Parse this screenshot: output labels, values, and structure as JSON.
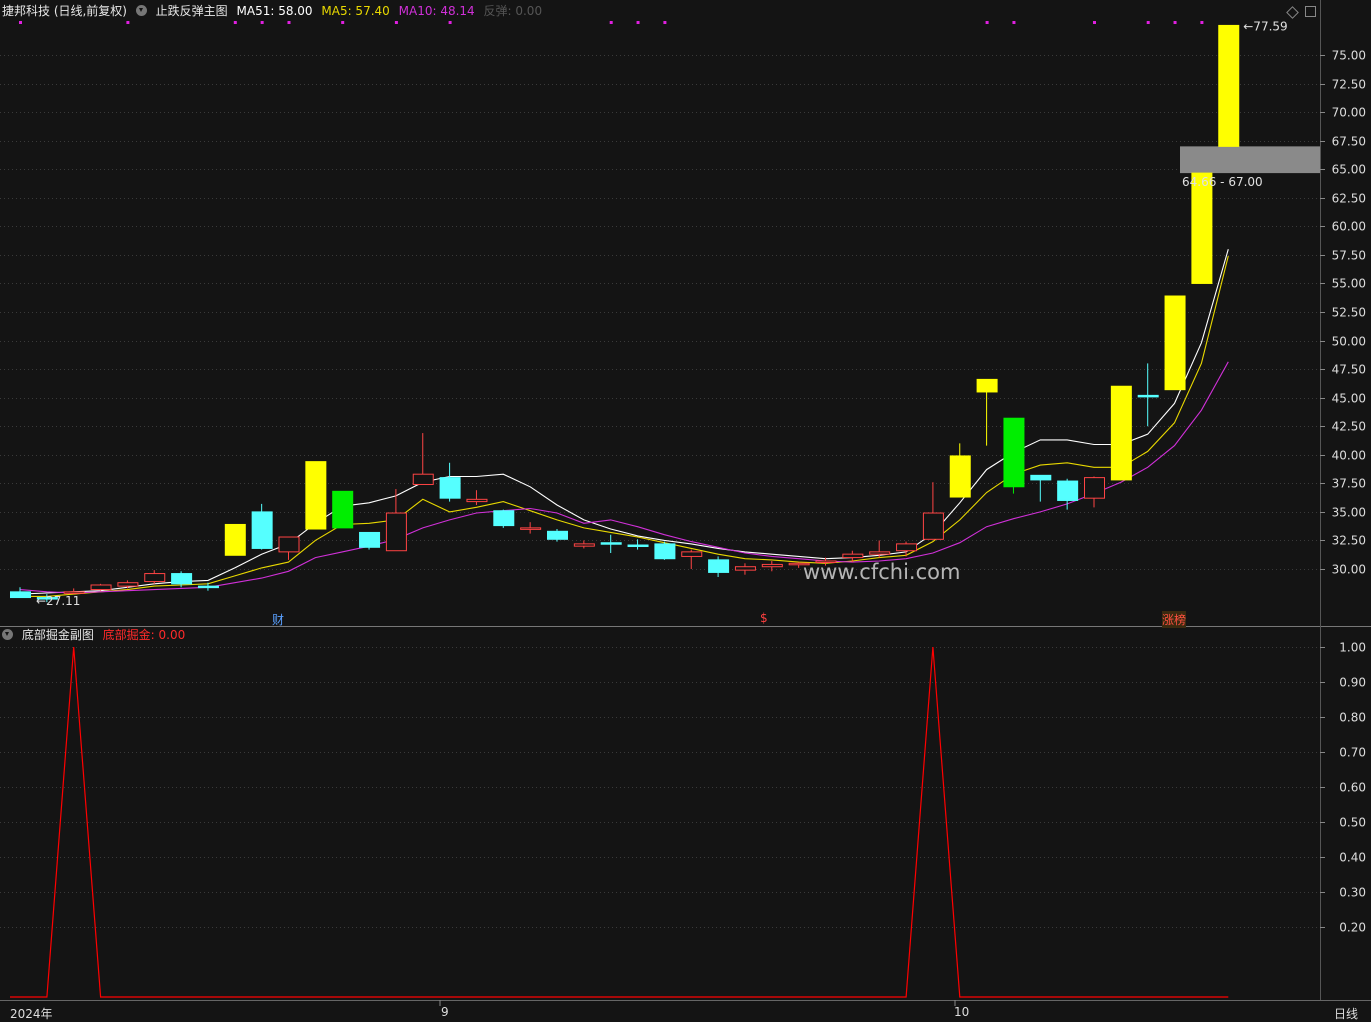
{
  "main_panel": {
    "stock_title": "捷邦科技 (日线,前复权)",
    "indicator_name": "止跌反弹主图",
    "ma51_label": "MA51: 58.00",
    "ma5_label": "MA5: 57.40",
    "ma10_label": "MA10: 48.14",
    "rebound_label": "反弹: 0.00",
    "high_label": "77.59",
    "low_label": "27.11",
    "zone_label": "64.66 - 67.00",
    "watermark": "www.cfchi.com",
    "markers": [
      {
        "label": "财",
        "color": "#5aa0ff"
      },
      {
        "label": "$",
        "color": "#ff4040"
      },
      {
        "label": "涨榜",
        "color": "#ff5040"
      }
    ]
  },
  "sub_panel": {
    "indicator_name": "底部掘金副图",
    "value_label": "底部掘金: 0.00"
  },
  "footer": {
    "x_labels": [
      "2024年",
      "9",
      "10"
    ],
    "period_label": "日线"
  },
  "colors": {
    "background": "#141414",
    "up": "#ff4444",
    "down": "#55ffff",
    "limit_up": "#ffff00",
    "strong_down": "#00ee00",
    "ma51": "#ffffff",
    "ma5": "#e8d800",
    "ma10": "#d030d8",
    "signal": "#ff0000",
    "grid": "#3a3a3a",
    "dots": "#e020e0",
    "zone": "#8a8a8a"
  },
  "chart_data": [
    {
      "type": "candlestick",
      "y_axis_ticks": [
        "75.00",
        "72.50",
        "70.00",
        "67.50",
        "65.00",
        "62.50",
        "60.00",
        "57.50",
        "55.00",
        "52.50",
        "50.00",
        "47.50",
        "45.00",
        "42.50",
        "40.00",
        "37.50",
        "35.00",
        "32.50",
        "30.00"
      ],
      "ylim": [
        26.0,
        78.5
      ],
      "candles": [
        {
          "o": 28.0,
          "h": 28.4,
          "l": 27.5,
          "c": 27.5,
          "k": "down"
        },
        {
          "o": 27.4,
          "h": 27.8,
          "l": 27.1,
          "c": 27.5,
          "k": "down"
        },
        {
          "o": 28.0,
          "h": 28.3,
          "l": 27.8,
          "c": 28.0,
          "k": "up"
        },
        {
          "o": 28.2,
          "h": 28.7,
          "l": 28.1,
          "c": 28.6,
          "k": "up"
        },
        {
          "o": 28.5,
          "h": 29.0,
          "l": 28.3,
          "c": 28.8,
          "k": "up"
        },
        {
          "o": 28.9,
          "h": 29.9,
          "l": 28.7,
          "c": 29.6,
          "k": "up"
        },
        {
          "o": 29.6,
          "h": 29.8,
          "l": 28.4,
          "c": 28.7,
          "k": "down"
        },
        {
          "o": 28.5,
          "h": 28.8,
          "l": 28.1,
          "c": 28.5,
          "k": "down"
        },
        {
          "o": 31.2,
          "h": 33.9,
          "l": 31.2,
          "c": 33.9,
          "k": "limit"
        },
        {
          "o": 35.0,
          "h": 35.7,
          "l": 31.7,
          "c": 31.8,
          "k": "down"
        },
        {
          "o": 31.5,
          "h": 32.8,
          "l": 30.8,
          "c": 32.8,
          "k": "up"
        },
        {
          "o": 33.5,
          "h": 39.4,
          "l": 33.5,
          "c": 39.4,
          "k": "limit"
        },
        {
          "o": 36.8,
          "h": 36.8,
          "l": 33.6,
          "c": 33.6,
          "k": "strong"
        },
        {
          "o": 33.2,
          "h": 33.2,
          "l": 31.7,
          "c": 31.9,
          "k": "down"
        },
        {
          "o": 31.6,
          "h": 37.0,
          "l": 31.6,
          "c": 34.9,
          "k": "up"
        },
        {
          "o": 37.4,
          "h": 41.9,
          "l": 37.4,
          "c": 38.3,
          "k": "up"
        },
        {
          "o": 38.0,
          "h": 39.3,
          "l": 35.9,
          "c": 36.2,
          "k": "down"
        },
        {
          "o": 35.9,
          "h": 36.9,
          "l": 35.6,
          "c": 36.1,
          "k": "up"
        },
        {
          "o": 35.1,
          "h": 35.2,
          "l": 33.6,
          "c": 33.8,
          "k": "down"
        },
        {
          "o": 33.6,
          "h": 34.1,
          "l": 33.1,
          "c": 33.6,
          "k": "up"
        },
        {
          "o": 33.3,
          "h": 33.5,
          "l": 32.4,
          "c": 32.6,
          "k": "down"
        },
        {
          "o": 32.2,
          "h": 32.5,
          "l": 31.8,
          "c": 32.0,
          "k": "up"
        },
        {
          "o": 32.3,
          "h": 33.0,
          "l": 31.4,
          "c": 32.2,
          "k": "down"
        },
        {
          "o": 32.1,
          "h": 32.6,
          "l": 31.7,
          "c": 32.0,
          "k": "down"
        },
        {
          "o": 32.2,
          "h": 32.4,
          "l": 30.8,
          "c": 30.9,
          "k": "down"
        },
        {
          "o": 31.1,
          "h": 31.7,
          "l": 30.0,
          "c": 31.5,
          "k": "up"
        },
        {
          "o": 30.8,
          "h": 31.1,
          "l": 29.3,
          "c": 29.7,
          "k": "down"
        },
        {
          "o": 29.9,
          "h": 30.5,
          "l": 29.5,
          "c": 30.2,
          "k": "up"
        },
        {
          "o": 30.2,
          "h": 30.7,
          "l": 29.8,
          "c": 30.4,
          "k": "up"
        },
        {
          "o": 30.5,
          "h": 30.6,
          "l": 30.1,
          "c": 30.5,
          "k": "up"
        },
        {
          "o": 30.6,
          "h": 31.0,
          "l": 30.3,
          "c": 30.7,
          "k": "up"
        },
        {
          "o": 31.0,
          "h": 31.6,
          "l": 30.6,
          "c": 31.3,
          "k": "up"
        },
        {
          "o": 31.3,
          "h": 32.5,
          "l": 31.0,
          "c": 31.5,
          "k": "up"
        },
        {
          "o": 31.6,
          "h": 32.4,
          "l": 31.1,
          "c": 32.2,
          "k": "up"
        },
        {
          "o": 32.6,
          "h": 37.6,
          "l": 32.6,
          "c": 34.9,
          "k": "up"
        },
        {
          "o": 36.3,
          "h": 41.0,
          "l": 36.3,
          "c": 39.9,
          "k": "limit"
        },
        {
          "o": 46.6,
          "h": 46.6,
          "l": 40.8,
          "c": 45.5,
          "k": "limit"
        },
        {
          "o": 43.2,
          "h": 43.2,
          "l": 36.6,
          "c": 37.2,
          "k": "strong"
        },
        {
          "o": 38.2,
          "h": 38.2,
          "l": 35.9,
          "c": 37.8,
          "k": "down"
        },
        {
          "o": 37.7,
          "h": 37.9,
          "l": 35.2,
          "c": 36.0,
          "k": "down"
        },
        {
          "o": 36.2,
          "h": 38.1,
          "l": 35.4,
          "c": 38.0,
          "k": "up"
        },
        {
          "o": 37.8,
          "h": 46.0,
          "l": 37.8,
          "c": 46.0,
          "k": "limit"
        },
        {
          "o": 45.2,
          "h": 48.0,
          "l": 42.5,
          "c": 45.2,
          "k": "down"
        },
        {
          "o": 45.7,
          "h": 53.9,
          "l": 45.7,
          "c": 53.9,
          "k": "limit"
        },
        {
          "o": 55.0,
          "h": 64.66,
          "l": 55.0,
          "c": 64.66,
          "k": "limit"
        },
        {
          "o": 67.0,
          "h": 77.59,
          "l": 67.0,
          "c": 77.59,
          "k": "limit"
        }
      ],
      "series": [
        {
          "name": "MA51",
          "values": [
            27.8,
            27.9,
            28.0,
            28.1,
            28.4,
            28.7,
            28.9,
            29.0,
            30.1,
            31.3,
            32.2,
            34.0,
            35.5,
            35.8,
            36.4,
            37.6,
            38.1,
            38.1,
            38.3,
            37.2,
            35.6,
            34.3,
            33.5,
            32.9,
            32.5,
            32.2,
            31.8,
            31.5,
            31.3,
            31.1,
            30.9,
            31.0,
            31.2,
            31.5,
            33.1,
            35.8,
            38.7,
            40.2,
            41.3,
            41.3,
            40.9,
            40.9,
            41.8,
            44.5,
            49.8,
            58.0
          ]
        },
        {
          "name": "MA5",
          "values": [
            27.6,
            27.6,
            27.8,
            28.0,
            28.2,
            28.5,
            28.6,
            28.7,
            29.4,
            30.1,
            30.6,
            32.5,
            33.9,
            34.0,
            34.3,
            36.1,
            35.0,
            35.4,
            35.9,
            35.1,
            34.3,
            33.6,
            33.2,
            32.8,
            32.3,
            31.8,
            31.3,
            30.9,
            30.8,
            30.6,
            30.5,
            30.7,
            31.0,
            31.2,
            32.4,
            34.3,
            36.7,
            38.3,
            39.1,
            39.3,
            38.9,
            38.9,
            40.3,
            42.8,
            48.0,
            57.4
          ]
        },
        {
          "name": "MA10",
          "values": [
            28.2,
            28.0,
            27.9,
            28.0,
            28.1,
            28.2,
            28.3,
            28.4,
            28.8,
            29.2,
            29.8,
            31.0,
            31.5,
            32.0,
            32.6,
            33.6,
            34.3,
            34.9,
            35.1,
            35.3,
            34.9,
            34.0,
            34.3,
            33.7,
            33.0,
            32.4,
            31.9,
            31.4,
            31.1,
            30.9,
            30.7,
            30.6,
            30.7,
            30.9,
            31.4,
            32.3,
            33.7,
            34.4,
            35.0,
            35.7,
            36.6,
            37.6,
            38.9,
            40.8,
            43.9,
            48.14
          ]
        }
      ]
    },
    {
      "type": "line",
      "series": [
        {
          "name": "底部掘金",
          "values": [
            0,
            0,
            1,
            0,
            0,
            0,
            0,
            0,
            0,
            0,
            0,
            0,
            0,
            0,
            0,
            0,
            0,
            0,
            0,
            0,
            0,
            0,
            0,
            0,
            0,
            0,
            0,
            0,
            0,
            0,
            0,
            0,
            0,
            0,
            1,
            0,
            0,
            0,
            0,
            0,
            0,
            0,
            0,
            0,
            0,
            0
          ]
        }
      ],
      "y_axis_ticks": [
        "1.00",
        "0.90",
        "0.80",
        "0.70",
        "0.60",
        "0.50",
        "0.40",
        "0.30",
        "0.20"
      ],
      "ylim": [
        0,
        1
      ]
    }
  ]
}
